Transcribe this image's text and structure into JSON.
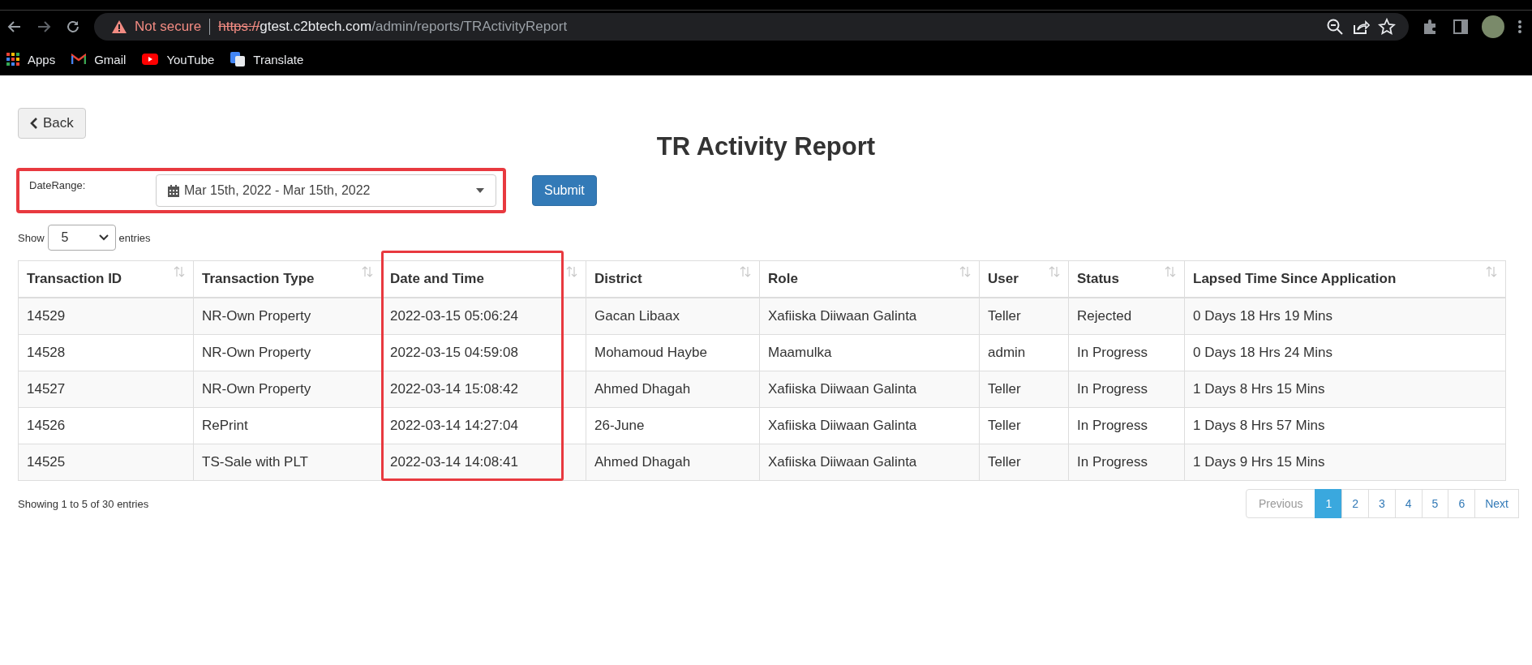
{
  "browser": {
    "security_label": "Not secure",
    "url_scheme": "https://",
    "url_host": "gtest.c2btech.com",
    "url_path": "/admin/reports/TRActivityReport",
    "bookmarks": [
      {
        "kind": "apps",
        "label": "Apps"
      },
      {
        "kind": "gmail",
        "label": "Gmail"
      },
      {
        "kind": "youtube",
        "label": "YouTube"
      },
      {
        "kind": "translate",
        "label": "Translate"
      }
    ]
  },
  "back_button": "Back",
  "title": "TR Activity Report",
  "filter": {
    "label": "DateRange:",
    "value": "Mar 15th, 2022 - Mar 15th, 2022",
    "submit": "Submit"
  },
  "length": {
    "prefix": "Show",
    "value": "5",
    "suffix": "entries"
  },
  "table": {
    "columns": [
      "Transaction ID",
      "Transaction Type",
      "Date and Time",
      "District",
      "Role",
      "User",
      "Status",
      "Lapsed Time Since Application"
    ],
    "rows": [
      [
        "14529",
        "NR-Own Property",
        "2022-03-15 05:06:24",
        "Gacan Libaax",
        "Xafiiska Diiwaan Galinta",
        "Teller",
        "Rejected",
        "0 Days 18 Hrs 19 Mins"
      ],
      [
        "14528",
        "NR-Own Property",
        "2022-03-15 04:59:08",
        "Mohamoud Haybe",
        "Maamulka",
        "admin",
        "In Progress",
        "0 Days 18 Hrs 24 Mins"
      ],
      [
        "14527",
        "NR-Own Property",
        "2022-03-14 15:08:42",
        "Ahmed Dhagah",
        "Xafiiska Diiwaan Galinta",
        "Teller",
        "In Progress",
        "1 Days 8 Hrs 15 Mins"
      ],
      [
        "14526",
        "RePrint",
        "2022-03-14 14:27:04",
        "26-June",
        "Xafiiska Diiwaan Galinta",
        "Teller",
        "In Progress",
        "1 Days 8 Hrs 57 Mins"
      ],
      [
        "14525",
        "TS-Sale with PLT",
        "2022-03-14 14:08:41",
        "Ahmed Dhagah",
        "Xafiiska Diiwaan Galinta",
        "Teller",
        "In Progress",
        "1 Days 9 Hrs 15 Mins"
      ]
    ]
  },
  "info": "Showing 1 to 5 of 30 entries",
  "pagination": {
    "previous": "Previous",
    "next": "Next",
    "pages": [
      {
        "label": "1",
        "selected": true
      },
      {
        "label": "2",
        "selected": false
      },
      {
        "label": "3",
        "selected": false
      },
      {
        "label": "4",
        "selected": false
      },
      {
        "label": "5",
        "selected": false
      },
      {
        "label": "6",
        "selected": false
      }
    ]
  }
}
